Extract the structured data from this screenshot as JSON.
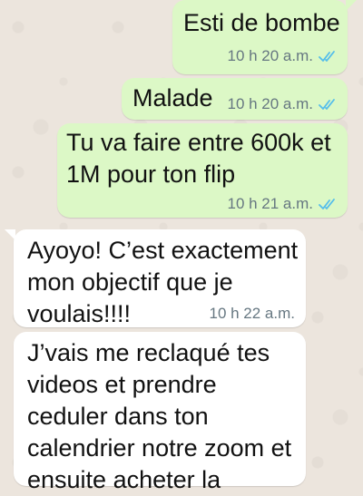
{
  "colors": {
    "background": "#ece5dd",
    "outgoing_bubble": "#dcf8c6",
    "incoming_bubble": "#ffffff",
    "read_ticks": "#53bdeb",
    "timestamp": "#667781"
  },
  "messages": [
    {
      "direction": "outgoing",
      "text": "Esti de bombe",
      "time": "10 h 20 a.m.",
      "status_icon": "double-check-read-icon"
    },
    {
      "direction": "outgoing",
      "text": "Malade",
      "time": "10 h 20 a.m.",
      "status_icon": "double-check-read-icon"
    },
    {
      "direction": "outgoing",
      "text": "Tu va faire entre 600k et 1M pour ton flip",
      "time": "10 h 21 a.m.",
      "status_icon": "double-check-read-icon"
    },
    {
      "direction": "incoming",
      "text": "Ayoyo! C’est exactement mon objectif que je voulais!!!!",
      "time": "10 h 22 a.m."
    },
    {
      "direction": "incoming",
      "text": "J’vais me reclaqué tes videos et prendre ceduler dans ton calendrier notre zoom et ensuite acheter la"
    }
  ]
}
